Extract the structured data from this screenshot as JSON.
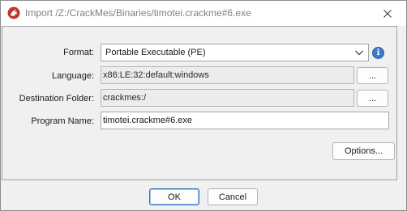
{
  "window": {
    "title": "Import /Z:/CrackMes/Binaries/timotei.crackme#6.exe",
    "close_glyph": "✕"
  },
  "form": {
    "format_label": "Format:",
    "format_value": "Portable Executable (PE)",
    "info_glyph": "i",
    "language_label": "Language:",
    "language_value": "x86:LE:32:default:windows",
    "language_browse_label": "...",
    "destination_label": "Destination Folder:",
    "destination_value": "crackmes:/",
    "destination_browse_label": "...",
    "program_name_label": "Program Name:",
    "program_name_value": "timotei.crackme#6.exe"
  },
  "buttons": {
    "options_label": "Options...",
    "ok_label": "OK",
    "cancel_label": "Cancel"
  },
  "colors": {
    "accent": "#2f6fc3",
    "info_icon": "#3d79c9",
    "app_icon": "#c0392b"
  },
  "icons": {
    "app": "ghidra-dragon-icon",
    "info": "info-icon",
    "dropdown": "chevron-down-icon",
    "close": "close-icon"
  }
}
